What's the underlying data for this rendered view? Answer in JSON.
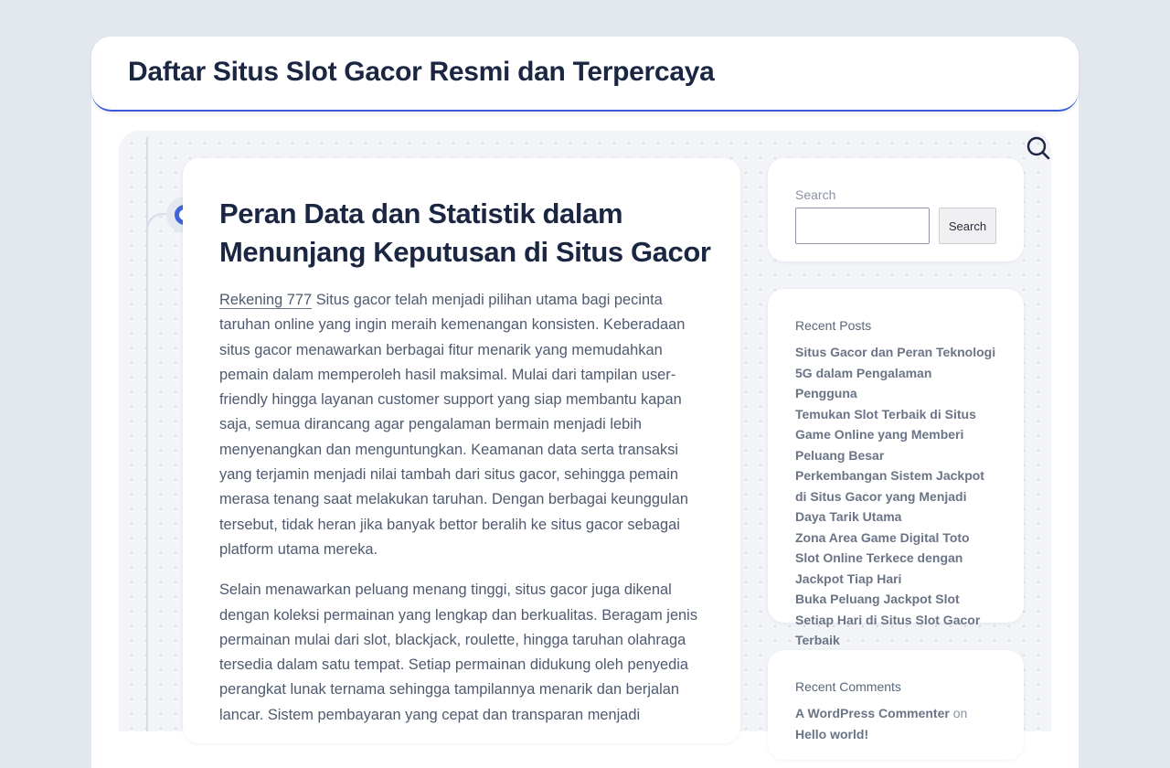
{
  "header": {
    "site_title": "Daftar Situs Slot Gacor Resmi dan Terpercaya"
  },
  "article": {
    "title": "Peran Data dan Statistik dalam Menunjang Keputusan di Situs Gacor",
    "link_text": "Rekening 777",
    "paragraph1_rest": " Situs gacor telah menjadi pilihan utama bagi pecinta taruhan online yang ingin meraih kemenangan konsisten. Keberadaan situs gacor menawarkan berbagai fitur menarik yang memudahkan pemain dalam memperoleh hasil maksimal. Mulai dari tampilan user-friendly hingga layanan customer support yang siap membantu kapan saja, semua dirancang agar pengalaman bermain menjadi lebih menyenangkan dan menguntungkan. Keamanan data serta transaksi yang terjamin menjadi nilai tambah dari situs gacor, sehingga pemain merasa tenang saat melakukan taruhan. Dengan berbagai keunggulan tersebut, tidak heran jika banyak bettor beralih ke situs gacor sebagai platform utama mereka.",
    "paragraph2": "Selain menawarkan peluang menang tinggi, situs gacor juga dikenal dengan koleksi permainan yang lengkap dan berkualitas. Beragam jenis permainan mulai dari slot, blackjack, roulette, hingga taruhan olahraga tersedia dalam satu tempat. Setiap permainan didukung oleh penyedia perangkat lunak ternama sehingga tampilannya menarik dan berjalan lancar. Sistem pembayaran yang cepat dan transparan menjadi"
  },
  "sidebar": {
    "search": {
      "label": "Search",
      "input_value": "",
      "button_label": "Search"
    },
    "recent_posts": {
      "title": "Recent Posts",
      "items": [
        "Situs Gacor dan Peran Teknologi 5G dalam Pengalaman Pengguna",
        "Temukan Slot Terbaik di Situs Game Online yang Memberi Peluang Besar",
        "Perkembangan Sistem Jackpot di Situs Gacor yang Menjadi Daya Tarik Utama",
        "Zona Area Game Digital Toto Slot Online Terkece dengan Jackpot Tiap Hari",
        "Buka Peluang Jackpot Slot Setiap Hari di Situs Slot Gacor Terbaik"
      ]
    },
    "recent_comments": {
      "title": "Recent Comments",
      "author": "A WordPress Commenter",
      "on_text": "on",
      "post": "Hello world!"
    }
  },
  "icons": {
    "search_toggle": "search-icon",
    "timeline_marker": "timeline-dot-icon"
  },
  "colors": {
    "accent": "#3e63dd",
    "title": "#1b2742",
    "body_text": "#4f5a70",
    "background": "#e3e7ee"
  }
}
